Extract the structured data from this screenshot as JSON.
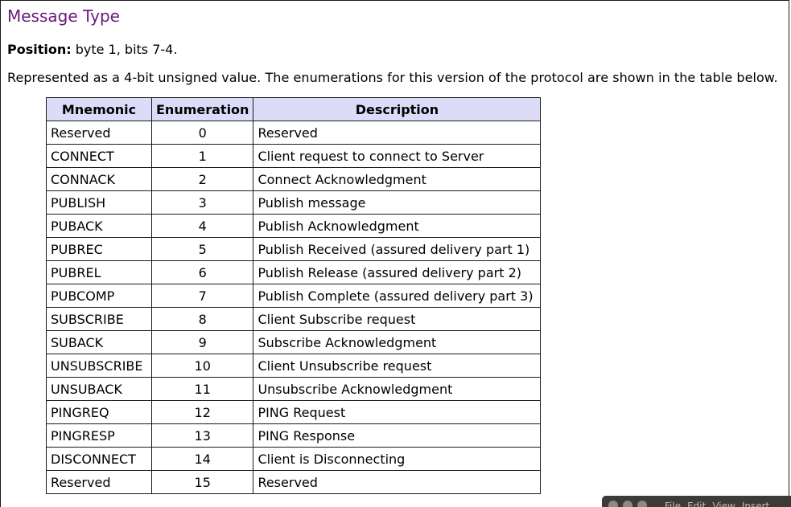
{
  "section": {
    "title": "Message Type",
    "position_label": "Position:",
    "position_value": " byte 1, bits 7-4.",
    "description": "Represented as a 4-bit unsigned value. The enumerations for this version of the protocol are shown in the table below."
  },
  "table": {
    "headers": [
      "Mnemonic",
      "Enumeration",
      "Description"
    ],
    "rows": [
      [
        "Reserved",
        "0",
        "Reserved"
      ],
      [
        "CONNECT",
        "1",
        "Client request to connect to Server"
      ],
      [
        "CONNACK",
        "2",
        "Connect Acknowledgment"
      ],
      [
        "PUBLISH",
        "3",
        "Publish message"
      ],
      [
        "PUBACK",
        "4",
        "Publish Acknowledgment"
      ],
      [
        "PUBREC",
        "5",
        "Publish Received (assured delivery part 1)"
      ],
      [
        "PUBREL",
        "6",
        "Publish Release (assured delivery part 2)"
      ],
      [
        "PUBCOMP",
        "7",
        "Publish Complete (assured delivery part 3)"
      ],
      [
        "SUBSCRIBE",
        "8",
        "Client Subscribe request"
      ],
      [
        "SUBACK",
        "9",
        "Subscribe Acknowledgment"
      ],
      [
        "UNSUBSCRIBE",
        "10",
        "Client Unsubscribe request"
      ],
      [
        "UNSUBACK",
        "11",
        "Unsubscribe Acknowledgment"
      ],
      [
        "PINGREQ",
        "12",
        "PING Request"
      ],
      [
        "PINGRESP",
        "13",
        "PING Response"
      ],
      [
        "DISCONNECT",
        "14",
        "Client is Disconnecting"
      ],
      [
        "Reserved",
        "15",
        "Reserved"
      ]
    ]
  },
  "window_strip": {
    "menu": [
      "File",
      "Edit",
      "View",
      "Insert"
    ]
  },
  "colors": {
    "title": "#6a1b7a",
    "header_bg": "#dcdcf8",
    "border": "#1a1a1a",
    "taskbar": "#3c3b37"
  }
}
